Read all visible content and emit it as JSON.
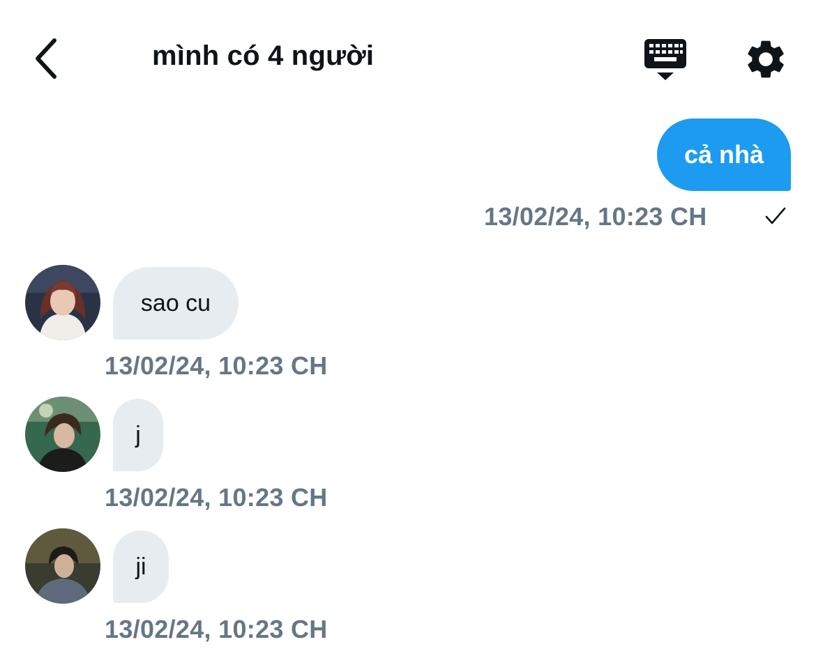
{
  "header": {
    "title": "mình có 4 người",
    "back_icon": "chevron-left-icon",
    "keyboard_icon": "keyboard-hide-icon",
    "settings_icon": "gear-icon"
  },
  "colors": {
    "outgoing_bubble": "#1d9bf0",
    "incoming_bubble": "#e7ecf0",
    "timestamp": "#657786"
  },
  "messages": [
    {
      "direction": "outgoing",
      "text": "cả nhà",
      "timestamp": "13/02/24, 10:23 CH",
      "read_icon": "checkmark-icon"
    },
    {
      "direction": "incoming",
      "text": "sao cu",
      "timestamp": "13/02/24, 10:23 CH"
    },
    {
      "direction": "incoming",
      "text": "j",
      "timestamp": "13/02/24, 10:23 CH"
    },
    {
      "direction": "incoming",
      "text": "ji",
      "timestamp": "13/02/24, 10:23 CH"
    }
  ]
}
